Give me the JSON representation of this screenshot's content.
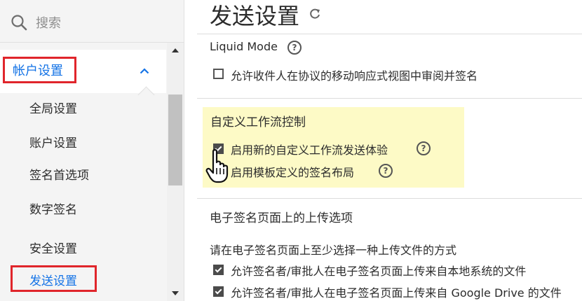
{
  "sidebar": {
    "search_placeholder": "搜索",
    "group_label": "帐户设置",
    "items": [
      {
        "label": "全局设置"
      },
      {
        "label": "账户设置"
      },
      {
        "label": "签名首选项"
      },
      {
        "label": "数字签名"
      },
      {
        "label": "安全设置"
      }
    ],
    "active_item": "发送设置"
  },
  "main": {
    "title": "发送设置",
    "liquid_mode": {
      "heading": "Liquid Mode",
      "option": "允许收件人在协议的移动响应式视图中审阅并签名",
      "checked": false
    },
    "custom_workflow": {
      "heading": "自定义工作流控制",
      "options": [
        {
          "label": "启用新的自定义工作流发送体验",
          "checked": true
        },
        {
          "label": "启用模板定义的签名布局",
          "checked": false
        }
      ]
    },
    "upload_options": {
      "heading": "电子签名页面上的上传选项",
      "description": "请在电子签名页面上至少选择一种上传文件的方式",
      "options": [
        {
          "label": "允许签名者/审批人在电子签名页面上传来自本地系统的文件",
          "checked": true
        },
        {
          "label": "允许签名者/审批人在电子签名页面上传来自 Google Drive 的文件",
          "checked": true
        }
      ]
    },
    "help_symbol": "?"
  },
  "colors": {
    "accent": "#1473e6",
    "annotation_red": "#e0252b",
    "highlight": "#fdfac6"
  },
  "icons": [
    "search-icon",
    "chevron-up-icon",
    "refresh-icon",
    "help-icon",
    "hand-cursor-icon"
  ]
}
